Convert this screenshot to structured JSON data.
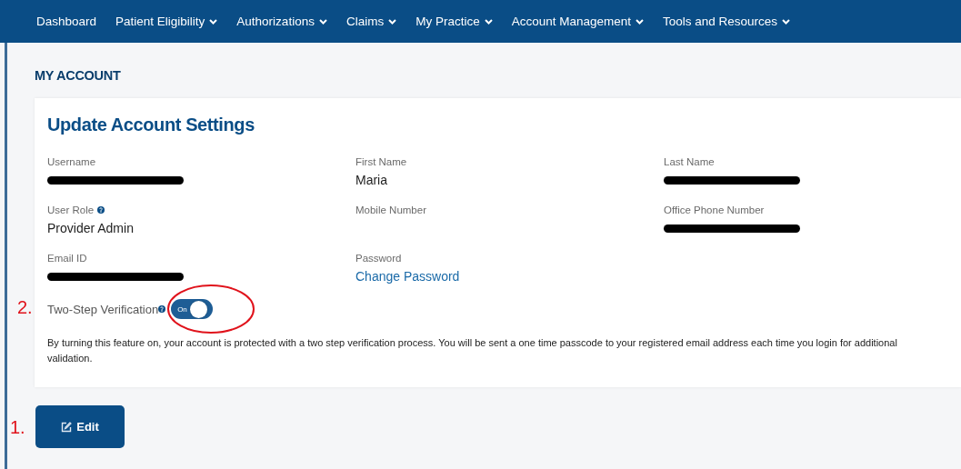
{
  "nav": [
    {
      "label": "Dashboard",
      "dropdown": false
    },
    {
      "label": "Patient Eligibility",
      "dropdown": true
    },
    {
      "label": "Authorizations",
      "dropdown": true
    },
    {
      "label": "Claims",
      "dropdown": true
    },
    {
      "label": "My Practice",
      "dropdown": true
    },
    {
      "label": "Account Management",
      "dropdown": true
    },
    {
      "label": "Tools and Resources",
      "dropdown": true
    }
  ],
  "page_title": "MY ACCOUNT",
  "card": {
    "title": "Update Account Settings",
    "fields": [
      {
        "label": "Username",
        "help": false,
        "kind": "redacted"
      },
      {
        "label": "First Name",
        "help": false,
        "kind": "text",
        "value": "Maria"
      },
      {
        "label": "Last Name",
        "help": false,
        "kind": "redacted"
      },
      {
        "label": "User Role",
        "help": true,
        "kind": "text",
        "value": "Provider Admin"
      },
      {
        "label": "Mobile Number",
        "help": false,
        "kind": "empty"
      },
      {
        "label": "Office Phone Number",
        "help": false,
        "kind": "redacted"
      },
      {
        "label": "Email ID",
        "help": false,
        "kind": "redacted"
      },
      {
        "label": "Password",
        "help": false,
        "kind": "link",
        "value": "Change Password"
      }
    ],
    "two_step": {
      "label": "Two-Step Verification",
      "on": true,
      "toggle_text": "On",
      "annotation": "2.",
      "description": "By turning this feature on, your account is protected with a two step verification process. You will be sent a one time passcode to your registered email address each time you login for additional validation."
    }
  },
  "edit_button": {
    "label": "Edit",
    "annotation": "1."
  }
}
